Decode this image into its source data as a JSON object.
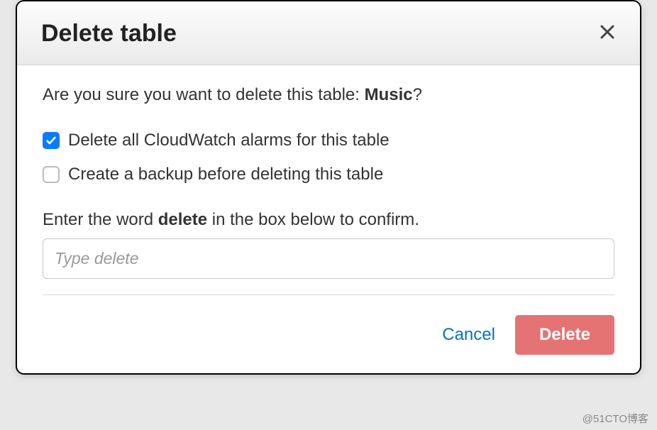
{
  "modal": {
    "title": "Delete table",
    "confirm_prefix": "Are you sure you want to delete this table: ",
    "table_name": "Music",
    "confirm_suffix": "?",
    "checkboxes": {
      "cloudwatch": {
        "label": "Delete all CloudWatch alarms for this table",
        "checked": true
      },
      "backup": {
        "label": "Create a backup before deleting this table",
        "checked": false
      }
    },
    "instruction_prefix": "Enter the word ",
    "instruction_keyword": "delete",
    "instruction_suffix": " in the box below to confirm.",
    "input_placeholder": "Type delete",
    "cancel_label": "Cancel",
    "delete_label": "Delete"
  },
  "watermark": "@51CTO博客"
}
